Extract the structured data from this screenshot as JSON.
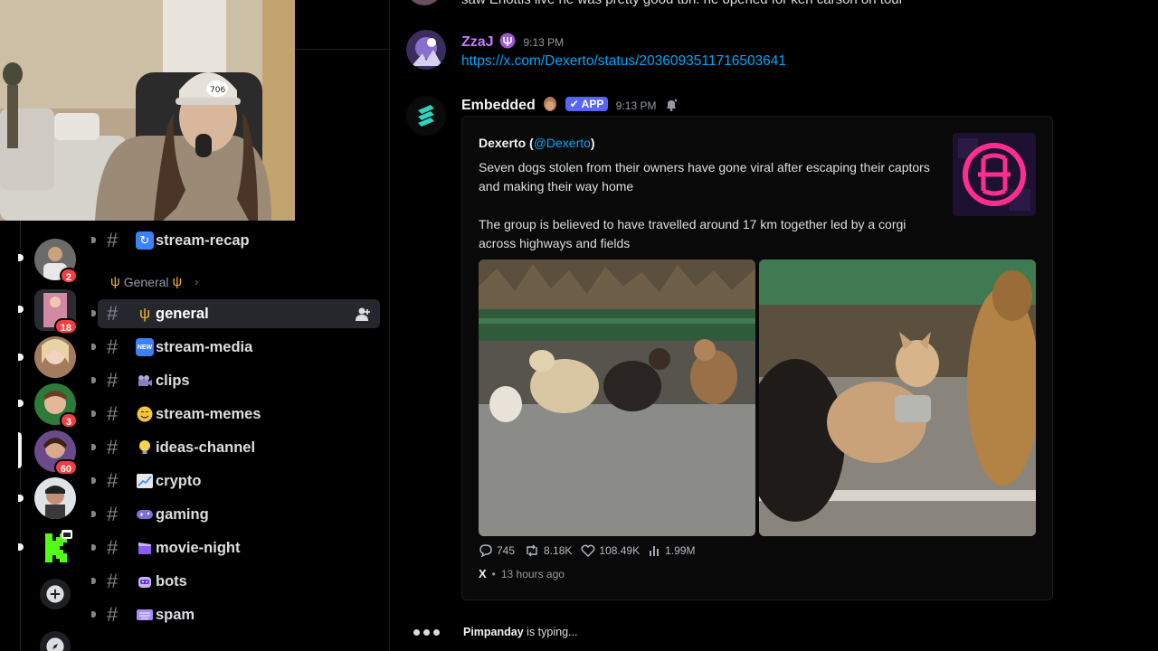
{
  "rail": {
    "badges": [
      "2",
      "18",
      "3",
      "60"
    ]
  },
  "channels": {
    "top_badge": "60",
    "category_label": "General",
    "items": [
      {
        "name": "stream-recap",
        "icon": "repeat-icon"
      },
      {
        "name": "general",
        "icon": "trident-icon"
      },
      {
        "name": "stream-media",
        "icon": "new-icon"
      },
      {
        "name": "clips",
        "icon": "camera-icon"
      },
      {
        "name": "stream-memes",
        "icon": "smile-icon"
      },
      {
        "name": "ideas-channel",
        "icon": "lightbulb-icon"
      },
      {
        "name": "crypto",
        "icon": "chart-icon"
      },
      {
        "name": "gaming",
        "icon": "gamepad-icon"
      },
      {
        "name": "movie-night",
        "icon": "clapper-icon"
      },
      {
        "name": "bots",
        "icon": "robot-icon"
      },
      {
        "name": "spam",
        "icon": "keyboard-icon"
      }
    ]
  },
  "chat": {
    "previous_message": "saw Enottis live he was pretty good tbh. he opened for ken carson on tour",
    "message1": {
      "author": "ZzaJ",
      "time": "9:13 PM",
      "link": "https://x.com/Dexerto/status/2036093511716503641"
    },
    "message2": {
      "author": "Embedded",
      "app_badge": "APP",
      "time": "9:13 PM",
      "embed": {
        "author_name": "Dexerto (",
        "author_handle": "@Dexerto",
        "author_close": ")",
        "line1": "Seven dogs stolen from their owners have gone viral after escaping their captors and making their way home",
        "line2": "The group is believed to have travelled around 17 km together led by a corgi across highways and fields",
        "replies": "745",
        "reposts": "8.18K",
        "likes": "108.49K",
        "views": "1.99M",
        "x_label": "X",
        "posted": "13 hours ago"
      }
    },
    "typing": {
      "user": "Pimpanday",
      "text": " is typing..."
    }
  },
  "colors": {
    "accent": "#5865f2",
    "link": "#00a8fc",
    "zzaj_name": "#c77dff",
    "badge_red": "#f23f43"
  }
}
